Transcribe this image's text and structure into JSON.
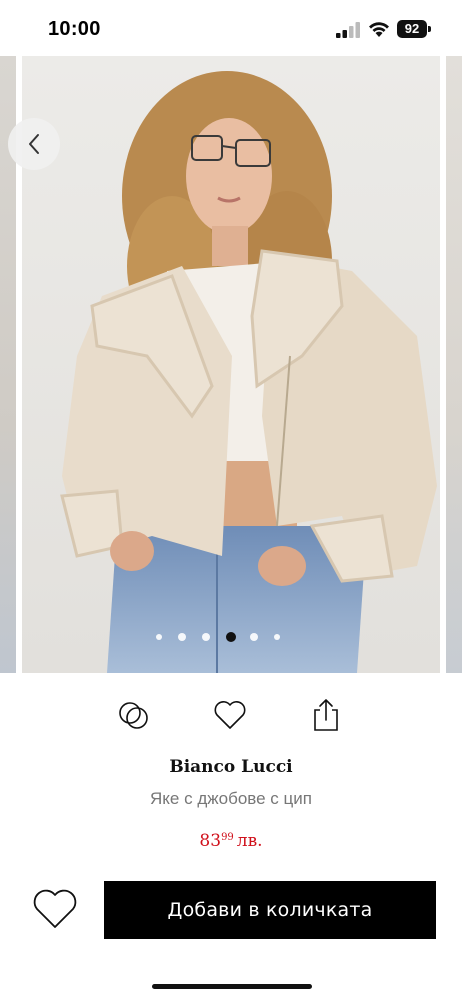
{
  "status_bar": {
    "time": "10:00",
    "battery": "92",
    "icons": [
      "cellular-signal-icon",
      "wifi-icon",
      "battery-icon"
    ]
  },
  "gallery": {
    "back_icon": "chevron-left-icon",
    "image_description_icon": "product-photo",
    "page_count": 6,
    "active_page": 4
  },
  "actions": {
    "items": [
      {
        "name": "compare-icon",
        "label": ""
      },
      {
        "name": "heart-icon",
        "label": ""
      },
      {
        "name": "share-icon",
        "label": ""
      }
    ]
  },
  "product": {
    "brand": "Bianco Lucci",
    "name": "Яке с джобове с цип",
    "price_whole": "83",
    "price_decimal": "99",
    "currency": "лв."
  },
  "bottom": {
    "wishlist_icon": "heart-outline-icon",
    "add_to_cart_label": "Добави в количката"
  },
  "colors": {
    "price_red": "#d0101b",
    "button_black": "#000000",
    "muted_text": "#777777"
  }
}
